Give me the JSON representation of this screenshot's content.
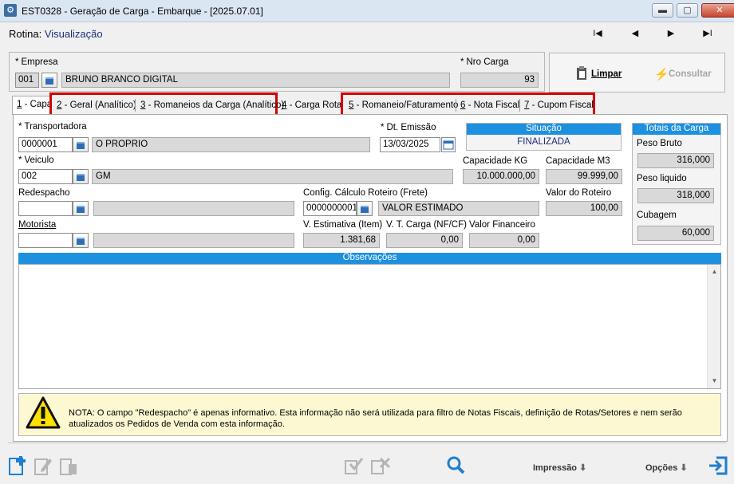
{
  "window": {
    "title": "EST0328 - Geração de Carga - Embarque - [2025.07.01]",
    "buttons": {
      "minimize": "▬",
      "maximize": "▢",
      "close": "✕"
    }
  },
  "rotina": {
    "label": "Rotina:",
    "value": "Visualização"
  },
  "nav": {
    "first": "I◀",
    "prev": "◀",
    "next": "▶",
    "last": "▶I"
  },
  "header": {
    "empresa_label": "Empresa",
    "empresa_code": "001",
    "empresa_name": "BRUNO BRANCO DIGITAL",
    "nro_carga_label": "Nro Carga",
    "nro_carga": "93",
    "limpar": "Limpar",
    "consultar": "Consultar"
  },
  "tabs": [
    {
      "num": "1",
      "label": " - Capa"
    },
    {
      "num": "2",
      "label": " - Geral (Analítico)"
    },
    {
      "num": "3",
      "label": " - Romaneios da Carga (Analítico)"
    },
    {
      "num": "4",
      "label": " - Carga Rota"
    },
    {
      "num": "5",
      "label": " - Romaneio/Faturamento"
    },
    {
      "num": "6",
      "label": " - Nota Fiscal"
    },
    {
      "num": "7",
      "label": " - Cupom Fiscal"
    }
  ],
  "capa": {
    "transportadora_label": "Transportadora",
    "transportadora_code": "0000001",
    "transportadora_name": "O PROPRIO",
    "dt_emissao_label": "Dt. Emissão",
    "dt_emissao": "13/03/2025",
    "situacao_label": "Situação",
    "situacao": "FINALIZADA",
    "veiculo_label": "Veiculo",
    "veiculo_code": "002",
    "veiculo_name": "GM",
    "capacidade_kg_label": "Capacidade KG",
    "capacidade_kg": "10.000.000,00",
    "capacidade_m3_label": "Capacidade M3",
    "capacidade_m3": "99.999,00",
    "redespacho_label": "Redespacho",
    "config_label": "Config. Cálculo Roteiro (Frete)",
    "config_code": "0000000001",
    "config_name": "VALOR ESTIMADO",
    "valor_roteiro_label": "Valor do Roteiro",
    "valor_roteiro": "100,00",
    "motorista_label": "Motorista",
    "v_estimativa_label": "V. Estimativa (Item)",
    "v_estimativa": "1.381,68",
    "vt_carga_label": "V. T. Carga (NF/CF)",
    "vt_carga": "0,00",
    "valor_financeiro_label": "Valor Financeiro",
    "valor_financeiro": "0,00",
    "observacoes_label": "Observações"
  },
  "totais": {
    "title": "Totais da Carga",
    "peso_bruto_label": "Peso Bruto",
    "peso_bruto": "316,000",
    "peso_liquido_label": "Peso liquido",
    "peso_liquido": "318,000",
    "cubagem_label": "Cubagem",
    "cubagem": "60,000"
  },
  "note": {
    "text": "NOTA:  O campo \"Redespacho\" é apenas informativo. Esta informação não será utilizada para filtro de Notas Fiscais, definição de Rotas/Setores e nem serão atualizados os Pedidos de Venda com esta informação."
  },
  "bottom": {
    "impressao": "Impressão",
    "opcoes": "Opções"
  },
  "colors": {
    "accent": "#1e90e0",
    "highlight": "#d40000"
  }
}
